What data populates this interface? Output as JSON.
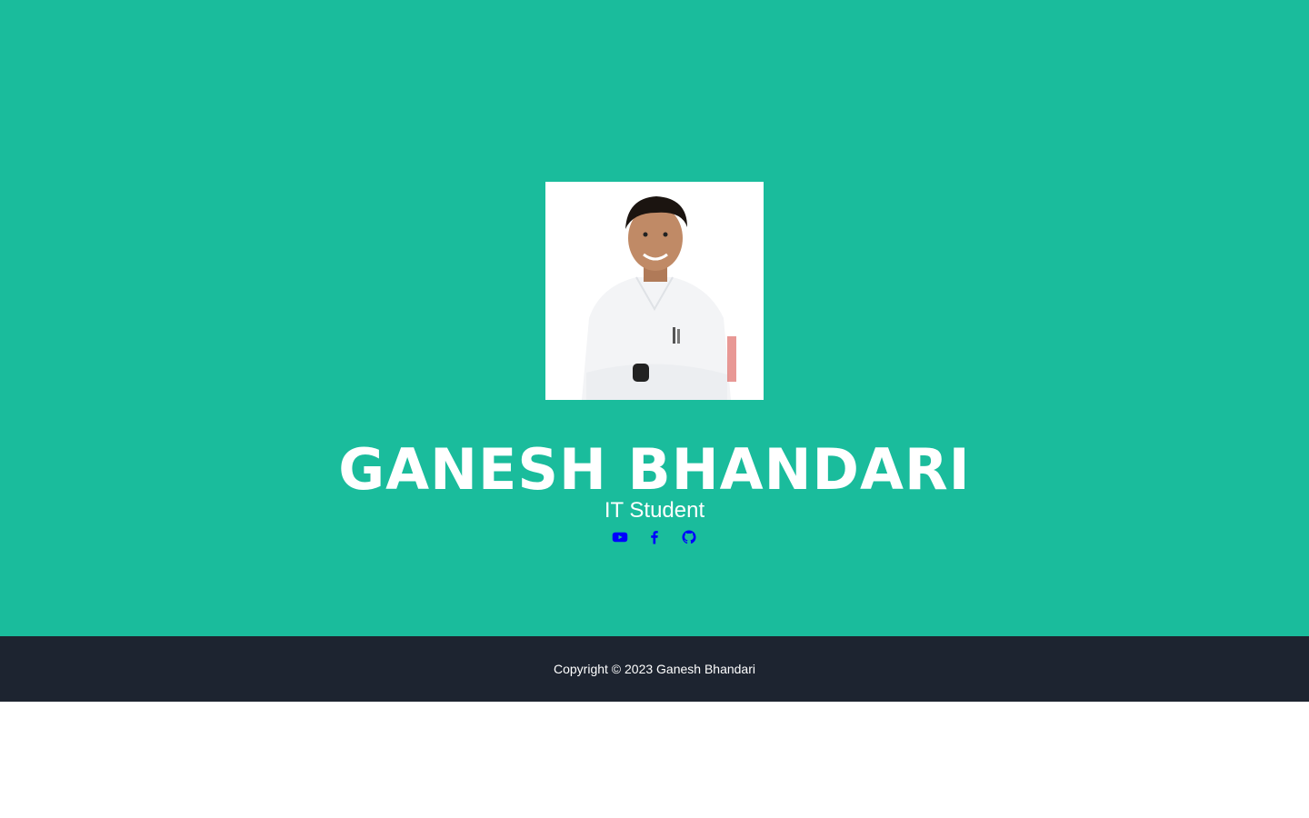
{
  "profile": {
    "name": "GANESH BHANDARI",
    "title": "IT Student",
    "photo_alt": "Ganesh Bhandari portrait"
  },
  "socials": [
    {
      "icon": "youtube-icon",
      "label": "YouTube"
    },
    {
      "icon": "facebook-icon",
      "label": "Facebook"
    },
    {
      "icon": "github-icon",
      "label": "GitHub"
    }
  ],
  "footer": {
    "copyright": "Copyright © 2023 Ganesh Bhandari"
  },
  "colors": {
    "hero_bg": "#1abc9c",
    "footer_bg": "#1d2430",
    "icon": "#0000ff",
    "text": "#ffffff"
  }
}
